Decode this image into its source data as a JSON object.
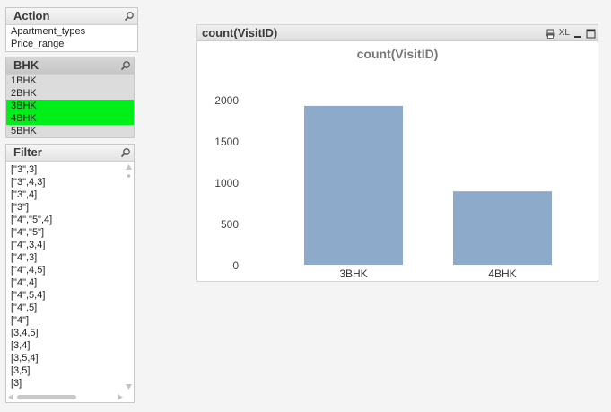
{
  "action_box": {
    "title": "Action",
    "items": [
      "Apartment_types",
      "Price_range"
    ]
  },
  "bhk_box": {
    "title": "BHK",
    "items": [
      {
        "label": "1BHK",
        "state": "excluded"
      },
      {
        "label": "2BHK",
        "state": "excluded"
      },
      {
        "label": "3BHK",
        "state": "selected"
      },
      {
        "label": "4BHK",
        "state": "selected"
      },
      {
        "label": "5BHK",
        "state": "excluded"
      }
    ]
  },
  "filter_box": {
    "title": "Filter",
    "items": [
      "[\"3\",3]",
      "[\"3\",4,3]",
      "[\"3\",4]",
      "[\"3\"]",
      "[\"4\",\"5\",4]",
      "[\"4\",\"5\"]",
      "[\"4\",3,4]",
      "[\"4\",3]",
      "[\"4\",4,5]",
      "[\"4\",4]",
      "[\"4\",5,4]",
      "[\"4\",5]",
      "[\"4\"]",
      "[3,4,5]",
      "[3,4]",
      "[3,5,4]",
      "[3,5]",
      "[3]"
    ]
  },
  "chart_window": {
    "caption": "count(VisitID)",
    "icons": [
      "print-icon",
      "xl-icon",
      "minimize-icon",
      "maximize-icon"
    ],
    "xl_label": "XL"
  },
  "chart_data": {
    "type": "bar",
    "title": "count(VisitID)",
    "categories": [
      "3BHK",
      "4BHK"
    ],
    "values": [
      1925,
      890
    ],
    "yticks": [
      0,
      500,
      1000,
      1500,
      2000
    ],
    "ylim": [
      0,
      2000
    ],
    "xlabel": "",
    "ylabel": "",
    "bar_color": "#8eaacb"
  },
  "colors": {
    "selected": "#00ee19",
    "excluded": "#dcdcdc"
  }
}
